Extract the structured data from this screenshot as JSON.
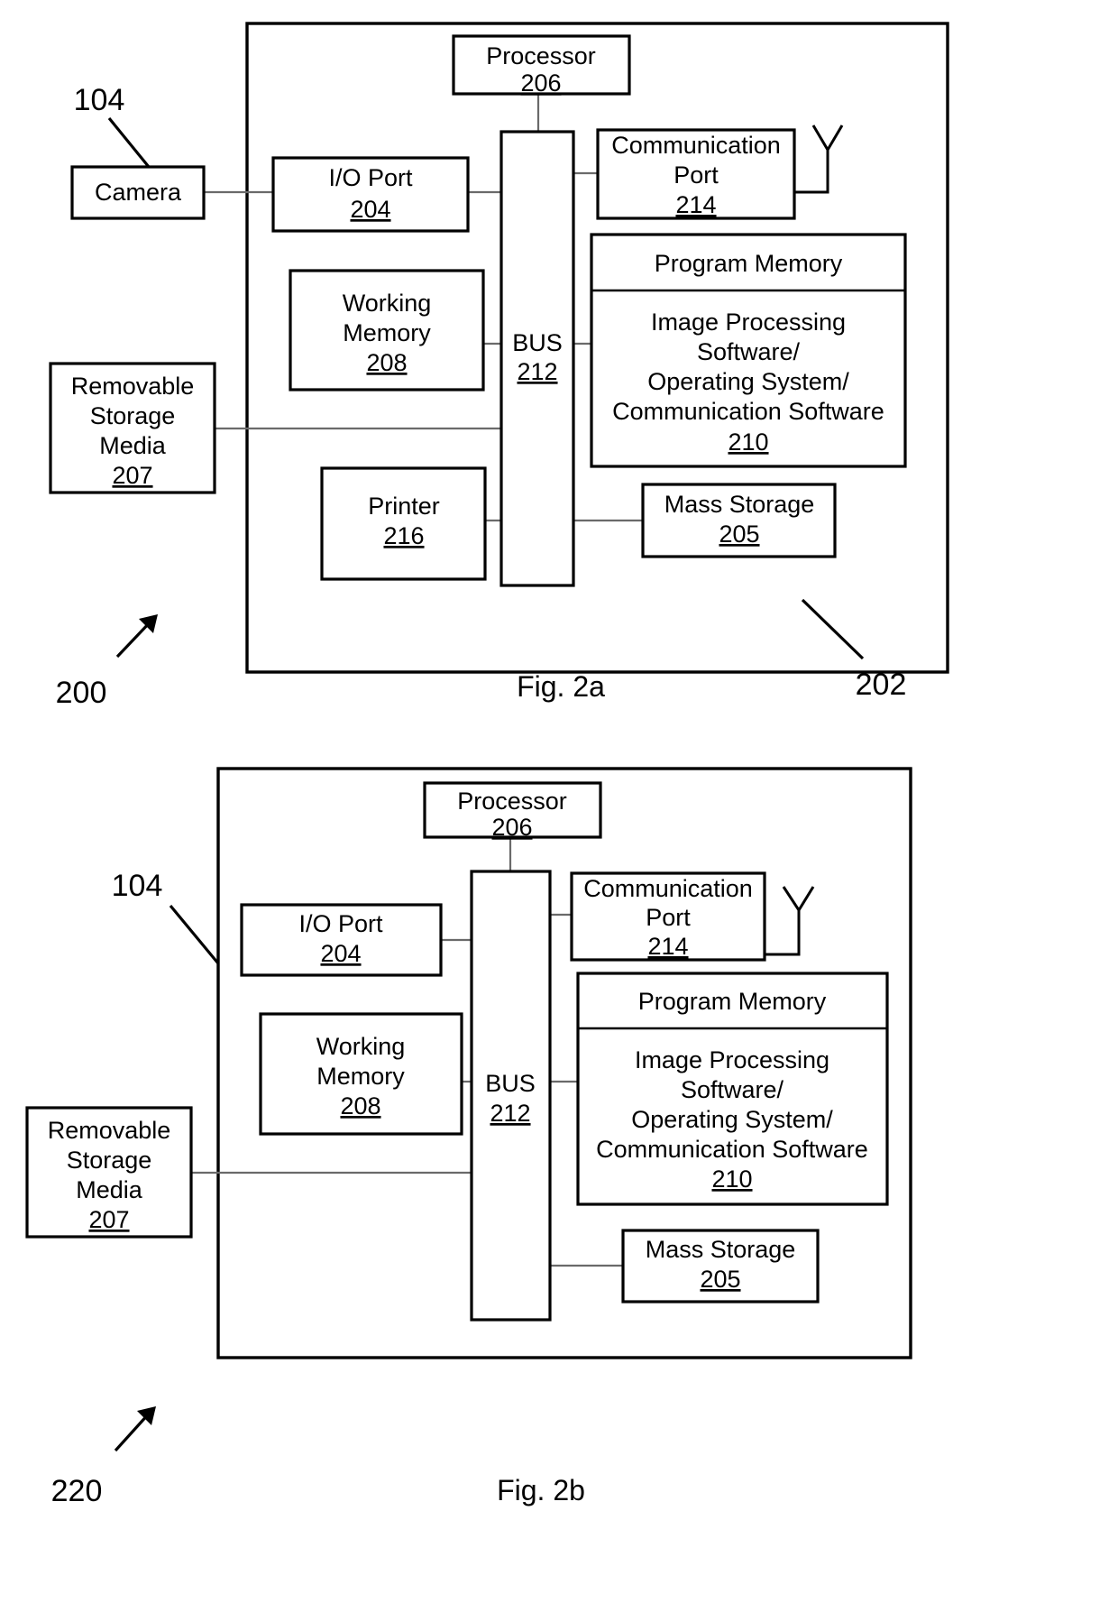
{
  "figures": [
    {
      "id": "fig-2a",
      "caption": "Fig. 2a",
      "system_label": "200",
      "device_label": "202",
      "camera_label": "104",
      "blocks": {
        "camera": {
          "title": "Camera",
          "ref": ""
        },
        "io_port": {
          "title": "I/O Port",
          "ref": "204"
        },
        "processor": {
          "title": "Processor",
          "ref": "206"
        },
        "comm_port": {
          "title_line1": "Communication",
          "title_line2": "Port",
          "ref": "214"
        },
        "working": {
          "title_line1": "Working",
          "title_line2": "Memory",
          "ref": "208"
        },
        "removable": {
          "title_line1": "Removable",
          "title_line2": "Storage",
          "title_line3": "Media",
          "ref": "207"
        },
        "printer": {
          "title": "Printer",
          "ref": "216"
        },
        "bus": {
          "title": "BUS",
          "ref": "212"
        },
        "mass": {
          "title": "Mass Storage",
          "ref": "205"
        },
        "program_memory": {
          "header": "Program Memory",
          "body_line1": "Image Processing",
          "body_line2": "Software/",
          "body_line3": "Operating System/",
          "body_line4": "Communication Software",
          "ref": "210"
        }
      }
    },
    {
      "id": "fig-2b",
      "caption": "Fig. 2b",
      "system_label": "220",
      "device_label": "104",
      "blocks": {
        "io_port": {
          "title": "I/O Port",
          "ref": "204"
        },
        "processor": {
          "title": "Processor",
          "ref": "206"
        },
        "comm_port": {
          "title_line1": "Communication",
          "title_line2": "Port",
          "ref": "214"
        },
        "working": {
          "title_line1": "Working",
          "title_line2": "Memory",
          "ref": "208"
        },
        "removable": {
          "title_line1": "Removable",
          "title_line2": "Storage",
          "title_line3": "Media",
          "ref": "207"
        },
        "bus": {
          "title": "BUS",
          "ref": "212"
        },
        "mass": {
          "title": "Mass Storage",
          "ref": "205"
        },
        "program_memory": {
          "header": "Program Memory",
          "body_line1": "Image Processing",
          "body_line2": "Software/",
          "body_line3": "Operating System/",
          "body_line4": "Communication Software",
          "ref": "210"
        }
      }
    }
  ],
  "icons": {
    "antenna": "antenna-icon",
    "arrow": "leader-arrow-icon"
  }
}
